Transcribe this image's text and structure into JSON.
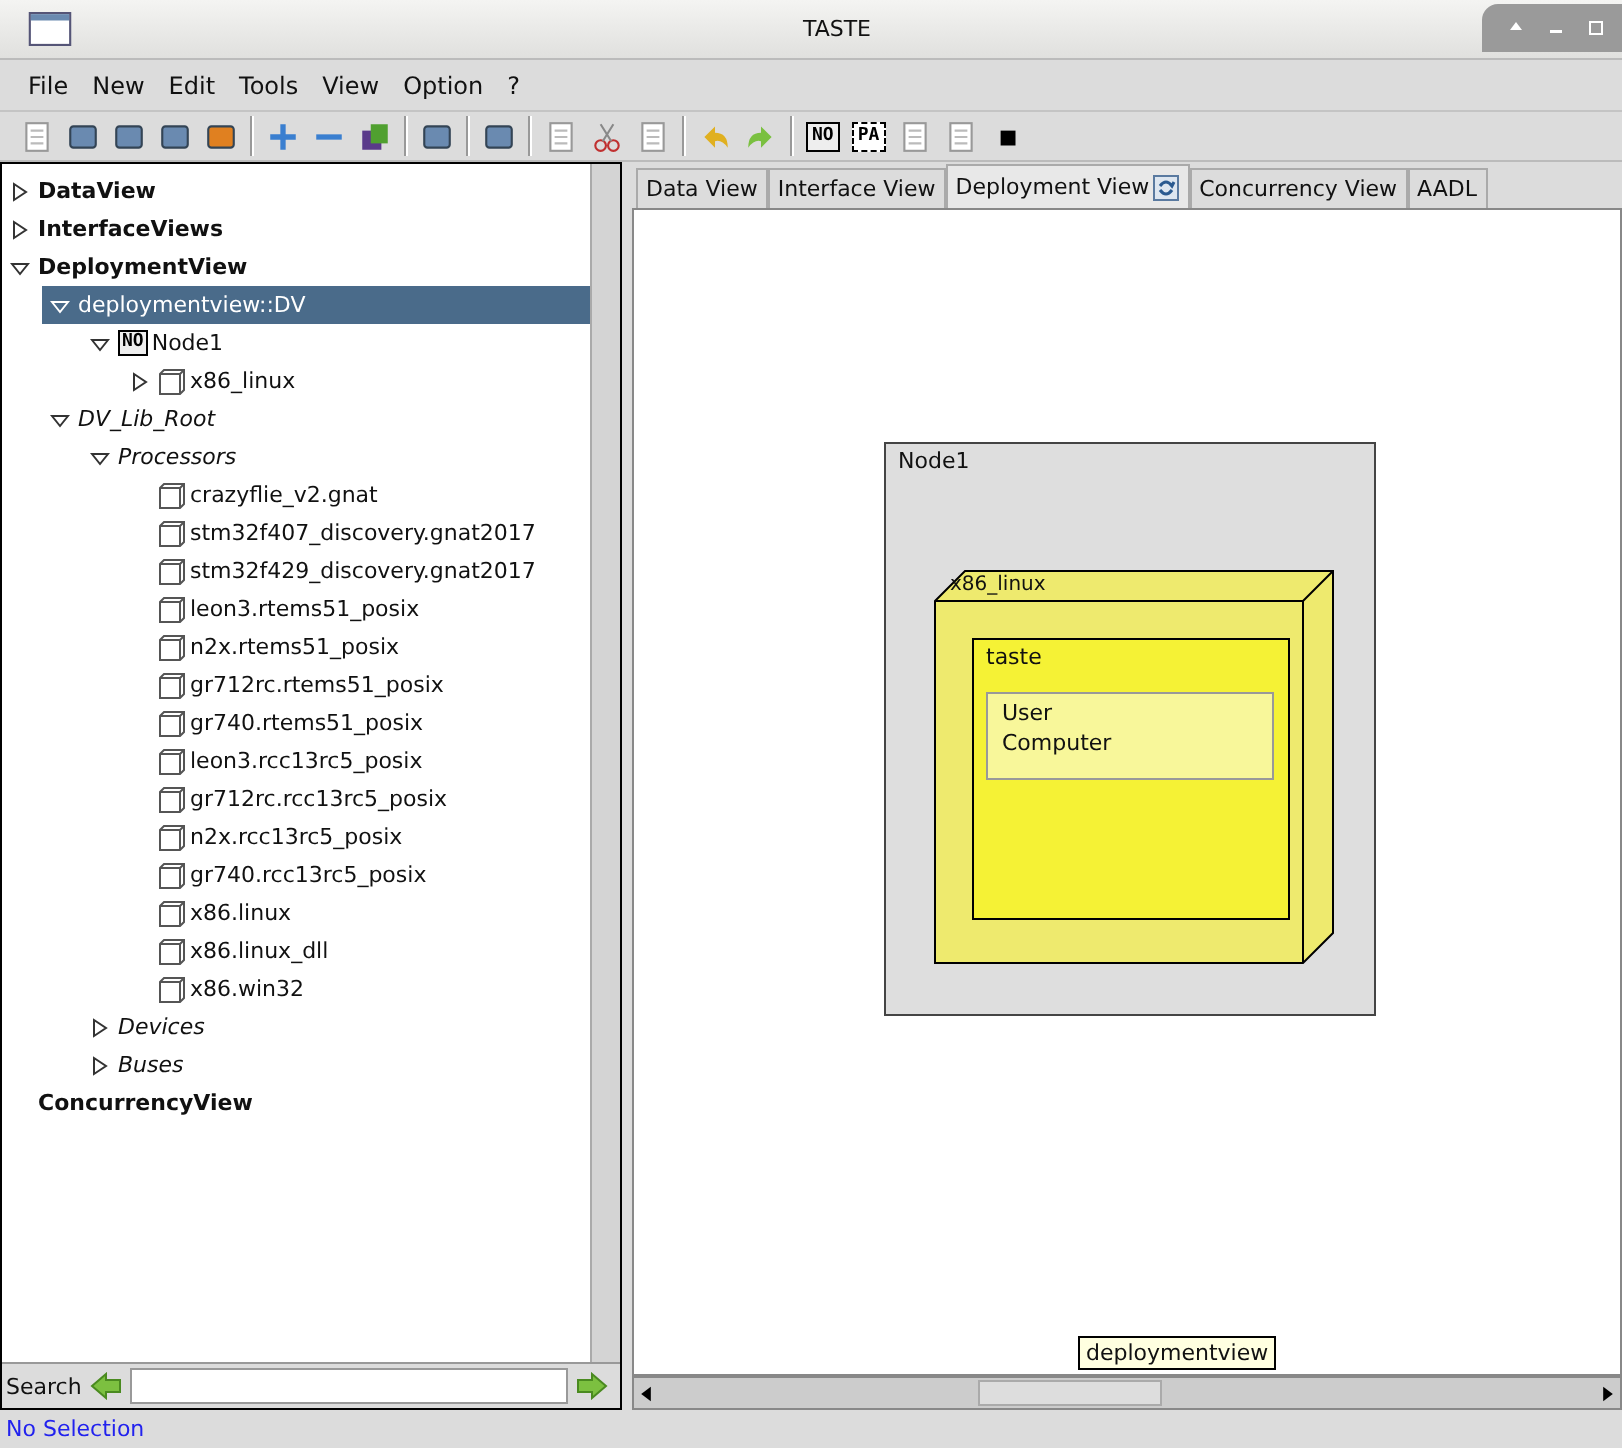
{
  "window": {
    "title": "TASTE"
  },
  "menu": [
    "File",
    "New",
    "Edit",
    "Tools",
    "View",
    "Option",
    "?"
  ],
  "toolbar": {
    "badges": [
      "NO",
      "PA"
    ]
  },
  "tree": [
    {
      "label": "DataView",
      "kind": "category",
      "expanded": false,
      "selected": false
    },
    {
      "label": "InterfaceViews",
      "kind": "category",
      "expanded": false,
      "selected": false
    },
    {
      "label": "DeploymentView",
      "kind": "category",
      "expanded": true,
      "selected": false,
      "children": [
        {
          "label": "deploymentview::DV",
          "kind": "item",
          "expanded": true,
          "selected": true,
          "children": [
            {
              "label": "Node1",
              "kind": "node",
              "badge": "NO",
              "expanded": true,
              "selected": false,
              "children": [
                {
                  "label": "x86_linux",
                  "kind": "processor",
                  "expanded": false,
                  "selected": false
                }
              ]
            }
          ]
        },
        {
          "label": "DV_Lib_Root",
          "kind": "group",
          "expanded": true,
          "selected": false,
          "children": [
            {
              "label": "Processors",
              "kind": "group",
              "expanded": true,
              "selected": false,
              "children": [
                {
                  "label": "crazyflie_v2.gnat",
                  "kind": "processor",
                  "selected": false
                },
                {
                  "label": "stm32f407_discovery.gnat2017",
                  "kind": "processor",
                  "selected": false
                },
                {
                  "label": "stm32f429_discovery.gnat2017",
                  "kind": "processor",
                  "selected": false
                },
                {
                  "label": "leon3.rtems51_posix",
                  "kind": "processor",
                  "selected": false
                },
                {
                  "label": "n2x.rtems51_posix",
                  "kind": "processor",
                  "selected": false
                },
                {
                  "label": "gr712rc.rtems51_posix",
                  "kind": "processor",
                  "selected": false
                },
                {
                  "label": "gr740.rtems51_posix",
                  "kind": "processor",
                  "selected": false
                },
                {
                  "label": "leon3.rcc13rc5_posix",
                  "kind": "processor",
                  "selected": false
                },
                {
                  "label": "gr712rc.rcc13rc5_posix",
                  "kind": "processor",
                  "selected": false
                },
                {
                  "label": "n2x.rcc13rc5_posix",
                  "kind": "processor",
                  "selected": false
                },
                {
                  "label": "gr740.rcc13rc5_posix",
                  "kind": "processor",
                  "selected": false
                },
                {
                  "label": "x86.linux",
                  "kind": "processor",
                  "selected": false
                },
                {
                  "label": "x86.linux_dll",
                  "kind": "processor",
                  "selected": false
                },
                {
                  "label": "x86.win32",
                  "kind": "processor",
                  "selected": false
                }
              ]
            },
            {
              "label": "Devices",
              "kind": "group",
              "expanded": false,
              "selected": false
            },
            {
              "label": "Buses",
              "kind": "group",
              "expanded": false,
              "selected": false
            }
          ]
        }
      ]
    },
    {
      "label": "ConcurrencyView",
      "kind": "category",
      "selected": false
    }
  ],
  "search": {
    "label": "Search"
  },
  "tabs": [
    {
      "label": "Data View",
      "selected": false
    },
    {
      "label": "Interface View",
      "selected": false
    },
    {
      "label": "Deployment View",
      "selected": true,
      "icon": true
    },
    {
      "label": "Concurrency View",
      "selected": false
    },
    {
      "label": "AADL",
      "selected": false
    }
  ],
  "diagram": {
    "node": "Node1",
    "processor": "x86_linux",
    "partition": "taste",
    "functions": [
      "User",
      "Computer"
    ]
  },
  "tooltip": "deploymentview",
  "status_bar": "No Selection"
}
